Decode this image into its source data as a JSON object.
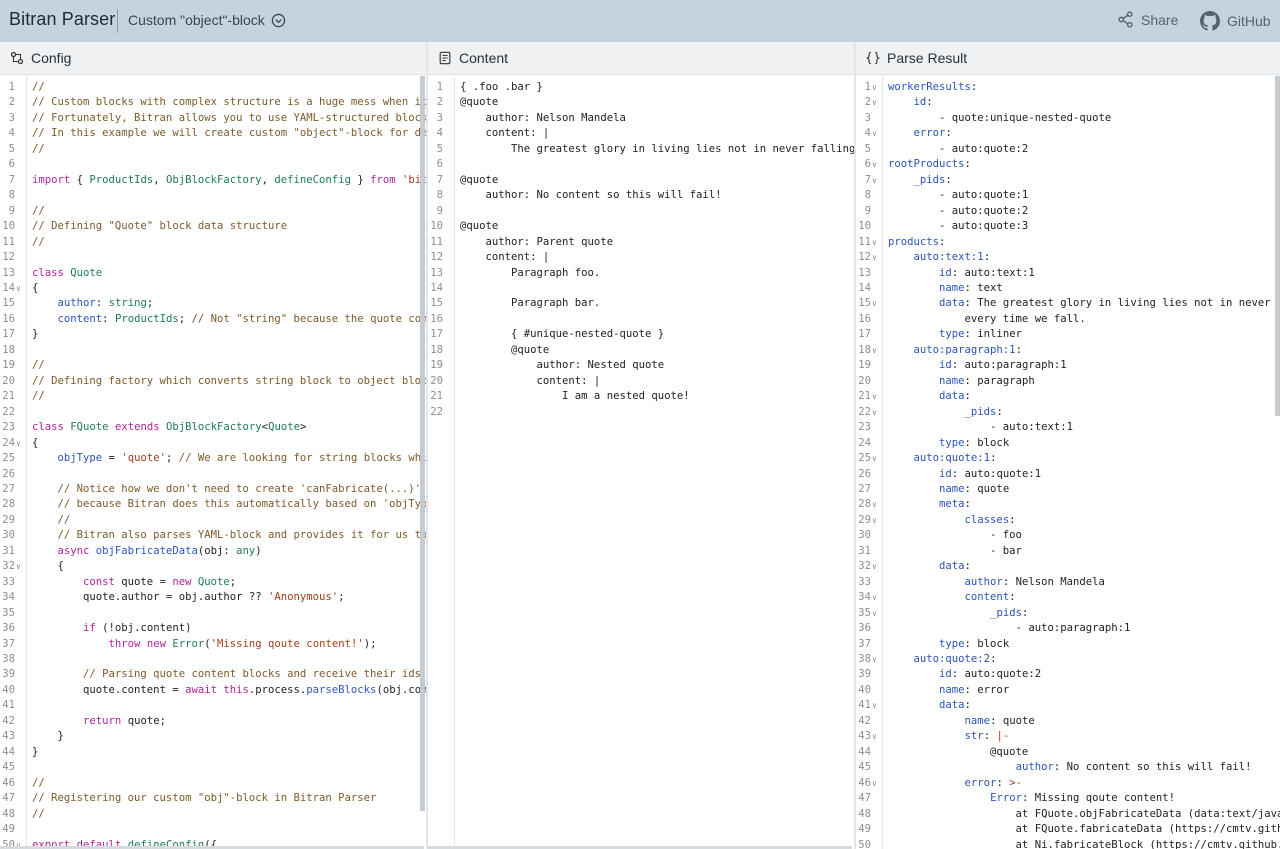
{
  "app": {
    "title": "Bitran Parser",
    "preset": "Custom \"object\"-block",
    "share_label": "Share",
    "github_label": "GitHub"
  },
  "panels": {
    "config": {
      "title": "Config",
      "lines": [
        "//",
        "// Custom blocks with complex structure is a huge mess when it co",
        "// Fortunately, Bitran allows you to use YAML-structured blocks w",
        "// In this example we will create custom \"object\"-block for desig",
        "//",
        "",
        "import { ProductIds, ObjBlockFactory, defineConfig } from 'bitran",
        "",
        "//",
        "// Defining \"Quote\" block data structure",
        "//",
        "",
        "class Quote",
        "{",
        "    author: string;",
        "    content: ProductIds; // Not \"string\" because the quote conten",
        "}",
        "",
        "//",
        "// Defining factory which converts string block to object block q",
        "//",
        "",
        "class FQuote extends ObjBlockFactory<Quote>",
        "{",
        "    objType = 'quote'; // We are looking for string blocks which",
        "",
        "    // Notice how we don't need to create 'canFabricate(...)' met",
        "    // because Bitran does this automatically based on 'objType'",
        "    //",
        "    // Bitran also parses YAML-block and provides it for us to fa",
        "    async objFabricateData(obj: any)",
        "    {",
        "        const quote = new Quote;",
        "        quote.author = obj.author ?? 'Anonymous';",
        "",
        "        if (!obj.content)",
        "            throw new Error('Missing qoute content!');",
        "",
        "        // Parsing quote content blocks and receive their ids",
        "        quote.content = await this.process.parseBlocks(obj.conten",
        "",
        "        return quote;",
        "    }",
        "}",
        "",
        "//",
        "// Registering our custom \"obj\"-block in Bitran Parser",
        "//",
        "",
        "export default defineConfig({"
      ],
      "folds": [
        14,
        24,
        32,
        50
      ]
    },
    "content": {
      "title": "Content",
      "lines": [
        "{ .foo .bar }",
        "@quote",
        "    author: Nelson Mandela",
        "    content: |",
        "        The greatest glory in living lies not in never falling, bu",
        "",
        "@quote",
        "    author: No content so this will fail!",
        "",
        "@quote",
        "    author: Parent quote",
        "    content: |",
        "        Paragraph foo.",
        "",
        "        Paragraph bar.",
        "",
        "        { #unique-nested-quote }",
        "        @quote",
        "            author: Nested quote",
        "            content: |",
        "                I am a nested quote!"
      ],
      "line_numbers": 22
    },
    "result": {
      "title": "Parse Result",
      "lines": [
        "workerResults:",
        "    id:",
        "        - quote:unique-nested-quote",
        "    error:",
        "        - auto:quote:2",
        "rootProducts:",
        "    _pids:",
        "        - auto:quote:1",
        "        - auto:quote:2",
        "        - auto:quote:3",
        "products:",
        "    auto:text:1:",
        "        id: auto:text:1",
        "        name: text",
        "        data: The greatest glory in living lies not in never fal",
        "            every time we fall.",
        "        type: inliner",
        "    auto:paragraph:1:",
        "        id: auto:paragraph:1",
        "        name: paragraph",
        "        data:",
        "            _pids:",
        "                - auto:text:1",
        "        type: block",
        "    auto:quote:1:",
        "        id: auto:quote:1",
        "        name: quote",
        "        meta:",
        "            classes:",
        "                - foo",
        "                - bar",
        "        data:",
        "            author: Nelson Mandela",
        "            content:",
        "                _pids:",
        "                    - auto:paragraph:1",
        "        type: block",
        "    auto:quote:2:",
        "        id: auto:quote:2",
        "        name: error",
        "        data:",
        "            name: quote",
        "            str: |-",
        "                @quote",
        "                    author: No content so this will fail!",
        "            error: >-",
        "                Error: Missing qoute content!",
        "                    at FQuote.objFabricateData (data:text/javas",
        "                    at FQuote.fabricateData (https://cmtv.githul",
        "                    at Ni.fabricateBlock (https://cmtv.github.i"
      ],
      "folds": [
        1,
        2,
        4,
        6,
        7,
        11,
        12,
        15,
        18,
        21,
        22,
        25,
        28,
        29,
        32,
        34,
        35,
        38,
        41,
        43,
        46
      ]
    }
  },
  "icons": {
    "config": "settings-nodes-icon",
    "content": "document-icon",
    "result": "braces-icon",
    "share": "share-icon",
    "github": "github-icon",
    "preset": "chevron-down-circle-icon"
  }
}
